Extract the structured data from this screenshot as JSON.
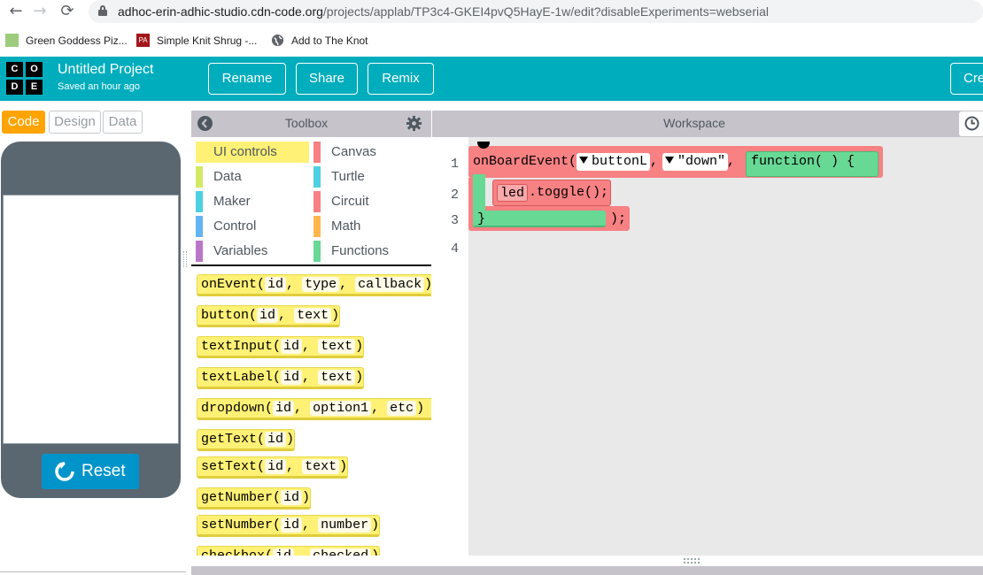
{
  "browser": {
    "url_host": "adhoc-erin-adhic-studio.cdn-code.org",
    "url_path": "/projects/applab/TP3c4-GKEI4pvQ5HayE-1w/edit?disableExperiments=webserial",
    "bookmarks": [
      {
        "label": "Green Goddess Piz...",
        "icon": "green-square-favicon"
      },
      {
        "label": "Simple Knit Shrug -...",
        "icon": "pa-favicon"
      },
      {
        "label": "Add to The Knot",
        "icon": "globe-icon"
      }
    ]
  },
  "header": {
    "logo_letters": [
      "C",
      "O",
      "D",
      "E"
    ],
    "project_name": "Untitled Project",
    "saved_status": "Saved an hour ago",
    "buttons": {
      "rename": "Rename",
      "share": "Share",
      "remix": "Remix",
      "create": "Cre"
    }
  },
  "mode_tabs": {
    "code": "Code",
    "design": "Design",
    "data": "Data",
    "active": "code"
  },
  "reset_label": "Reset",
  "toolbox": {
    "title": "Toolbox",
    "categories": [
      {
        "label": "UI controls",
        "color": "#fff176",
        "selected": true
      },
      {
        "label": "Canvas",
        "color": "#f78183"
      },
      {
        "label": "Data",
        "color": "#d3e965"
      },
      {
        "label": "Turtle",
        "color": "#4dd0e1"
      },
      {
        "label": "Maker",
        "color": "#4dd0e1"
      },
      {
        "label": "Circuit",
        "color": "#f78183"
      },
      {
        "label": "Control",
        "color": "#64b5f6"
      },
      {
        "label": "Math",
        "color": "#ffb74d"
      },
      {
        "label": "Variables",
        "color": "#bb77c7"
      },
      {
        "label": "Functions",
        "color": "#68d995"
      }
    ],
    "blocks": [
      {
        "name": "onEvent",
        "args": [
          "id",
          "type",
          "callback"
        ]
      },
      {
        "name": "button",
        "args": [
          "id",
          "text"
        ]
      },
      {
        "name": "textInput",
        "args": [
          "id",
          "text"
        ]
      },
      {
        "name": "textLabel",
        "args": [
          "id",
          "text"
        ]
      },
      {
        "name": "dropdown",
        "args": [
          "id",
          "option1",
          "etc"
        ],
        "extra": "←"
      },
      {
        "name": "getText",
        "args": [
          "id"
        ]
      },
      {
        "name": "setText",
        "args": [
          "id",
          "text"
        ]
      },
      {
        "name": "getNumber",
        "args": [
          "id"
        ]
      },
      {
        "name": "setNumber",
        "args": [
          "id",
          "number"
        ]
      },
      {
        "name": "checkbox",
        "args": [
          "id",
          "checked"
        ]
      }
    ]
  },
  "workspace": {
    "title": "Workspace",
    "line_numbers": [
      "1",
      "2",
      "3",
      "4"
    ],
    "code": {
      "func": "onBoardEvent(",
      "arg1": "buttonL",
      "comma1": ",",
      "arg2": "\"down\"",
      "comma2": ",",
      "callback": "function( ) {",
      "object": "led",
      "method": ".toggle();",
      "close_brace": "}",
      "close_paren": ");"
    }
  }
}
